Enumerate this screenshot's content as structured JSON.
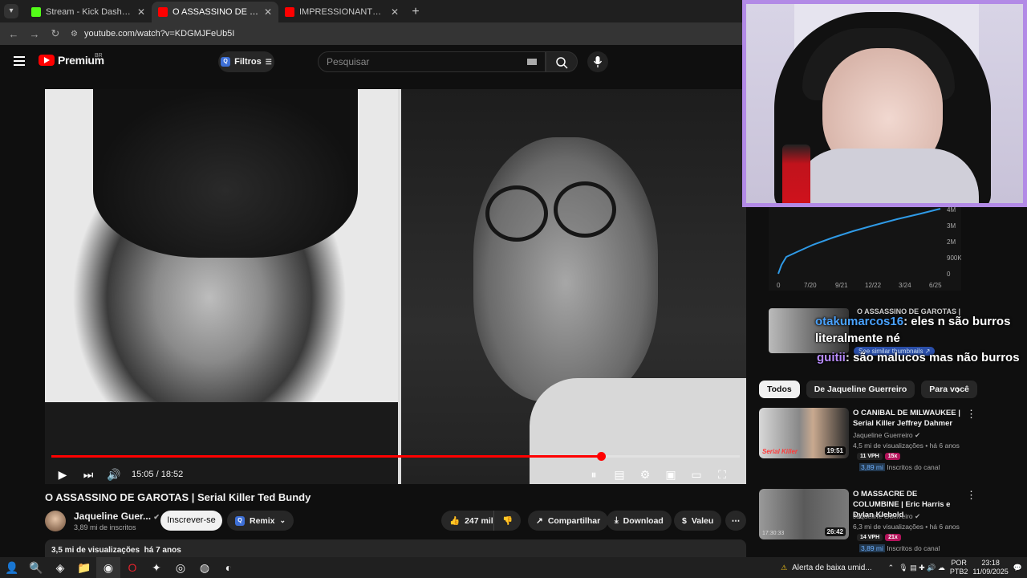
{
  "browser": {
    "tabs": [
      {
        "label": "Stream - Kick Dashboard",
        "icon": "kick-icon",
        "color": "#53fc18"
      },
      {
        "label": "O ASSASSINO DE GAROTAS | Se",
        "icon": "youtube-icon",
        "color": "#ff0000"
      },
      {
        "label": "IMPRESSIONANTE DEMAIS ESS",
        "icon": "youtube-icon",
        "color": "#ff0000"
      }
    ],
    "new_tab": "+",
    "url": "youtube.com/watch?v=KDGMJFeUb5I"
  },
  "yt": {
    "logo": "Premium",
    "region": "BR",
    "filters_label": "Filtros",
    "search_placeholder": "Pesquisar"
  },
  "player": {
    "time": "15:05 / 18:52",
    "progress": 0.798
  },
  "video": {
    "title": "O ASSASSINO DE GAROTAS | Serial Killer Ted Bundy",
    "channel": "Jaqueline Guer...",
    "subs": "3,89 mi de inscritos",
    "subscribe": "Inscrever-se",
    "remix": "Remix",
    "likes": "247 mil",
    "share": "Compartilhar",
    "download": "Download",
    "thanks": "Valeu",
    "views": "3,5 mi de visualizações",
    "age": "há 7 anos"
  },
  "graph": {
    "y_ticks": [
      "4M",
      "3M",
      "2M",
      "900K",
      "0"
    ],
    "x_ticks": [
      "0",
      "7/20",
      "9/21",
      "12/22",
      "3/24",
      "6/25"
    ]
  },
  "overlay": {
    "under_title": "O ASSASSINO DE GAROTAS |",
    "chat1_user": "otakumarcos16",
    "chat1_text": ": eles n são burros literalmente né",
    "similar": "See similar thumbnails ↗",
    "chat2_user": "guitii",
    "chat2_text": ": são malucos mas não burros"
  },
  "chips": [
    "Todos",
    "De Jaqueline Guerreiro",
    "Para você"
  ],
  "recs": [
    {
      "title": "O CANIBAL DE MILWAUKEE | Serial Killer Jeffrey Dahmer",
      "channel": "Jaqueline Guerreiro",
      "meta": "4,5 mi de visualizações • há 6 anos",
      "duration": "19:51",
      "vph": "11 VPH",
      "mult": "15x",
      "subs": "3,89 mi",
      "subs_label": "Inscritos do canal",
      "thumb_text": "Serial Killer"
    },
    {
      "title": "O MASSACRE DE COLUMBINE | Eric Harris e Dylan Klebold",
      "channel": "Jaqueline Guerreiro",
      "meta": "6,3 mi de visualizações • há 6 anos",
      "duration": "26:42",
      "vph": "14 VPH",
      "mult": "21x",
      "subs": "3,89 mi",
      "subs_label": "Inscritos do canal",
      "thumb_text": "17:30:33"
    }
  ],
  "taskbar": {
    "alert": "Alerta de baixa umid...",
    "lang": "POR",
    "layout": "PTB2",
    "time": "23:18",
    "date": "11/09/2025"
  },
  "colors": {
    "accent": "#ff0000",
    "cam_border": "#b28ae6",
    "graph_line": "#2f9ae6"
  }
}
